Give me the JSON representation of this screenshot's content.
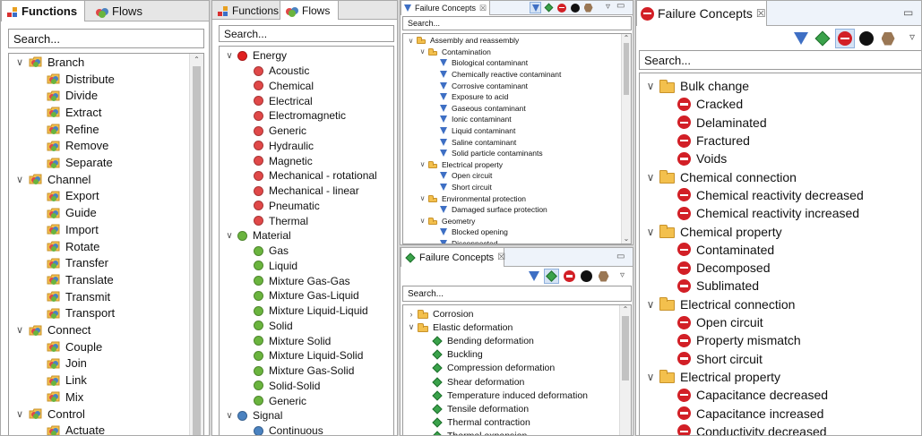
{
  "panel1": {
    "tabs": [
      {
        "label": "Functions"
      },
      {
        "label": "Flows"
      }
    ],
    "search_placeholder": "Search...",
    "items": [
      {
        "label": "Branch",
        "level": 0,
        "toggle": "∨"
      },
      {
        "label": "Distribute",
        "level": 1
      },
      {
        "label": "Divide",
        "level": 1
      },
      {
        "label": "Extract",
        "level": 1
      },
      {
        "label": "Refine",
        "level": 1
      },
      {
        "label": "Remove",
        "level": 1
      },
      {
        "label": "Separate",
        "level": 1
      },
      {
        "label": "Channel",
        "level": 0,
        "toggle": "∨"
      },
      {
        "label": "Export",
        "level": 1
      },
      {
        "label": "Guide",
        "level": 1
      },
      {
        "label": "Import",
        "level": 1
      },
      {
        "label": "Rotate",
        "level": 1
      },
      {
        "label": "Transfer",
        "level": 1
      },
      {
        "label": "Translate",
        "level": 1
      },
      {
        "label": "Transmit",
        "level": 1
      },
      {
        "label": "Transport",
        "level": 1
      },
      {
        "label": "Connect",
        "level": 0,
        "toggle": "∨"
      },
      {
        "label": "Couple",
        "level": 1
      },
      {
        "label": "Join",
        "level": 1
      },
      {
        "label": "Link",
        "level": 1
      },
      {
        "label": "Mix",
        "level": 1
      },
      {
        "label": "Control",
        "level": 0,
        "toggle": "∨"
      },
      {
        "label": "Actuate",
        "level": 1
      }
    ]
  },
  "panel2": {
    "tabs": [
      {
        "label": "Functions"
      },
      {
        "label": "Flows"
      }
    ],
    "search_placeholder": "Search...",
    "items": [
      {
        "label": "Energy",
        "level": 0,
        "toggle": "∨",
        "color": "#e02020"
      },
      {
        "label": "Acoustic",
        "level": 1,
        "color": "#e04848"
      },
      {
        "label": "Chemical",
        "level": 1,
        "color": "#e04848"
      },
      {
        "label": "Electrical",
        "level": 1,
        "color": "#e04848"
      },
      {
        "label": "Electromagnetic",
        "level": 1,
        "color": "#e04848"
      },
      {
        "label": "Generic",
        "level": 1,
        "color": "#e04848"
      },
      {
        "label": "Hydraulic",
        "level": 1,
        "color": "#e04848"
      },
      {
        "label": "Magnetic",
        "level": 1,
        "color": "#e04848"
      },
      {
        "label": "Mechanical - rotational",
        "level": 1,
        "color": "#e04848"
      },
      {
        "label": "Mechanical - linear",
        "level": 1,
        "color": "#e04848"
      },
      {
        "label": "Pneumatic",
        "level": 1,
        "color": "#e04848"
      },
      {
        "label": "Thermal",
        "level": 1,
        "color": "#e04848"
      },
      {
        "label": "Material",
        "level": 0,
        "toggle": "∨",
        "color": "#6ab43e"
      },
      {
        "label": "Gas",
        "level": 1,
        "color": "#6ab43e"
      },
      {
        "label": "Liquid",
        "level": 1,
        "color": "#6ab43e"
      },
      {
        "label": "Mixture Gas-Gas",
        "level": 1,
        "color": "#6ab43e"
      },
      {
        "label": "Mixture Gas-Liquid",
        "level": 1,
        "color": "#6ab43e"
      },
      {
        "label": "Mixture Liquid-Liquid",
        "level": 1,
        "color": "#6ab43e"
      },
      {
        "label": "Solid",
        "level": 1,
        "color": "#6ab43e"
      },
      {
        "label": "Mixture Solid",
        "level": 1,
        "color": "#6ab43e"
      },
      {
        "label": "Mixture Liquid-Solid",
        "level": 1,
        "color": "#6ab43e"
      },
      {
        "label": "Mixture Gas-Solid",
        "level": 1,
        "color": "#6ab43e"
      },
      {
        "label": "Solid-Solid",
        "level": 1,
        "color": "#6ab43e"
      },
      {
        "label": "Generic",
        "level": 1,
        "color": "#6ab43e"
      },
      {
        "label": "Signal",
        "level": 0,
        "toggle": "∨",
        "color": "#4a82c0"
      },
      {
        "label": "Continuous",
        "level": 1,
        "color": "#4a82c0"
      }
    ]
  },
  "panel3": {
    "title": "Failure Concepts",
    "close": "☒",
    "search_placeholder": "Search...",
    "items": [
      {
        "label": "Assembly and reassembly",
        "level": 0,
        "type": "folder",
        "toggle": "∨"
      },
      {
        "label": "Contamination",
        "level": 1,
        "type": "folder",
        "toggle": "∨"
      },
      {
        "label": "Biological contaminant",
        "level": 2,
        "type": "tri"
      },
      {
        "label": "Chemically reactive contaminant",
        "level": 2,
        "type": "tri"
      },
      {
        "label": "Corrosive contaminant",
        "level": 2,
        "type": "tri"
      },
      {
        "label": "Exposure to acid",
        "level": 2,
        "type": "tri"
      },
      {
        "label": "Gaseous contaminant",
        "level": 2,
        "type": "tri"
      },
      {
        "label": "Ionic contaminant",
        "level": 2,
        "type": "tri"
      },
      {
        "label": "Liquid contaminant",
        "level": 2,
        "type": "tri"
      },
      {
        "label": "Saline contaminant",
        "level": 2,
        "type": "tri"
      },
      {
        "label": "Solid particle contaminants",
        "level": 2,
        "type": "tri"
      },
      {
        "label": "Electrical property",
        "level": 1,
        "type": "folder",
        "toggle": "∨"
      },
      {
        "label": "Open circuit",
        "level": 2,
        "type": "tri"
      },
      {
        "label": "Short circuit",
        "level": 2,
        "type": "tri"
      },
      {
        "label": "Environmental protection",
        "level": 1,
        "type": "folder",
        "toggle": "∨"
      },
      {
        "label": "Damaged surface protection",
        "level": 2,
        "type": "tri"
      },
      {
        "label": "Geometry",
        "level": 1,
        "type": "folder",
        "toggle": "∨"
      },
      {
        "label": "Blocked opening",
        "level": 2,
        "type": "tri"
      },
      {
        "label": "Disconnected",
        "level": 2,
        "type": "tri"
      }
    ]
  },
  "panel4": {
    "title": "Failure Concepts",
    "close": "☒",
    "search_placeholder": "Search...",
    "items": [
      {
        "label": "Corrosion",
        "level": 0,
        "type": "folder",
        "toggle": "›"
      },
      {
        "label": "Elastic deformation",
        "level": 0,
        "type": "folder",
        "toggle": "∨"
      },
      {
        "label": "Bending deformation",
        "level": 1,
        "type": "dia"
      },
      {
        "label": "Buckling",
        "level": 1,
        "type": "dia"
      },
      {
        "label": "Compression deformation",
        "level": 1,
        "type": "dia"
      },
      {
        "label": "Shear deformation",
        "level": 1,
        "type": "dia"
      },
      {
        "label": "Temperature induced deformation",
        "level": 1,
        "type": "dia"
      },
      {
        "label": "Tensile deformation",
        "level": 1,
        "type": "dia"
      },
      {
        "label": "Thermal contraction",
        "level": 1,
        "type": "dia"
      },
      {
        "label": "Thermal expansion",
        "level": 1,
        "type": "dia"
      }
    ]
  },
  "panel5": {
    "title": "Failure Concepts",
    "close": "☒",
    "search_placeholder": "Search...",
    "items": [
      {
        "label": "Bulk change",
        "level": 0,
        "type": "folder",
        "toggle": "∨"
      },
      {
        "label": "Cracked",
        "level": 1,
        "type": "no"
      },
      {
        "label": "Delaminated",
        "level": 1,
        "type": "no"
      },
      {
        "label": "Fractured",
        "level": 1,
        "type": "no"
      },
      {
        "label": "Voids",
        "level": 1,
        "type": "no"
      },
      {
        "label": "Chemical connection",
        "level": 0,
        "type": "folder",
        "toggle": "∨"
      },
      {
        "label": "Chemical reactivity decreased",
        "level": 1,
        "type": "no"
      },
      {
        "label": "Chemical reactivity increased",
        "level": 1,
        "type": "no"
      },
      {
        "label": "Chemical property",
        "level": 0,
        "type": "folder",
        "toggle": "∨"
      },
      {
        "label": "Contaminated",
        "level": 1,
        "type": "no"
      },
      {
        "label": "Decomposed",
        "level": 1,
        "type": "no"
      },
      {
        "label": "Sublimated",
        "level": 1,
        "type": "no"
      },
      {
        "label": "Electrical connection",
        "level": 0,
        "type": "folder",
        "toggle": "∨"
      },
      {
        "label": "Open circuit",
        "level": 1,
        "type": "no"
      },
      {
        "label": "Property mismatch",
        "level": 1,
        "type": "no"
      },
      {
        "label": "Short circuit",
        "level": 1,
        "type": "no"
      },
      {
        "label": "Electrical property",
        "level": 0,
        "type": "folder",
        "toggle": "∨"
      },
      {
        "label": "Capacitance decreased",
        "level": 1,
        "type": "no"
      },
      {
        "label": "Capacitance increased",
        "level": 1,
        "type": "no"
      },
      {
        "label": "Conductivity decreased",
        "level": 1,
        "type": "no"
      }
    ]
  }
}
